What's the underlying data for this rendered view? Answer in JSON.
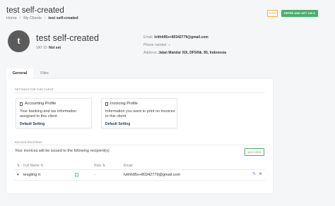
{
  "header": {
    "title": "test self-created",
    "breadcrumb": [
      "Home",
      "My Clients",
      "test self-created"
    ],
    "lang_button": "ID/EN",
    "refer_button": "REFER AND GET 100 K"
  },
  "client": {
    "avatar_letter": "t",
    "name": "test self-created",
    "vat_label": "VAT ID:",
    "vat_value": "Not set",
    "email_label": "Email:",
    "email_value": "lvithh95x+80342779@gmail.com",
    "phone_label": "Phone number:",
    "phone_value": "-",
    "address_label": "Address:",
    "address_value": "Jalan Mandar XIX, DF5/Nk. 85, Indonesia"
  },
  "tabs": [
    {
      "label": "General",
      "active": true
    },
    {
      "label": "Files",
      "active": false
    }
  ],
  "settings": {
    "section_label": "SETTINGS FOR THIS CLIENT",
    "cards": [
      {
        "icon": "document-icon",
        "title": "Accounting Profile",
        "description": "Your banking and tax information assigned to this client.",
        "link": "Default Setting"
      },
      {
        "icon": "document-icon",
        "title": "Invoicing Profile",
        "description": "Information you want to print on invoices to this client.",
        "link": "Default Setting"
      }
    ]
  },
  "recipients": {
    "section_label": "INVOICE RECIPIENT",
    "description": "Your invoices will be issued to the following recipient(s)",
    "add_button": "ADD NEW",
    "columns": [
      "Full Name",
      "Role",
      "Email"
    ],
    "rows": [
      {
        "name": "tesgting rt",
        "role": "-",
        "email": "lvithh95x+80342779@gmail.com"
      }
    ]
  },
  "colors": {
    "accent_green": "#4caf6a",
    "accent_orange": "#f0b030",
    "link_navy": "#1f3b5e"
  }
}
